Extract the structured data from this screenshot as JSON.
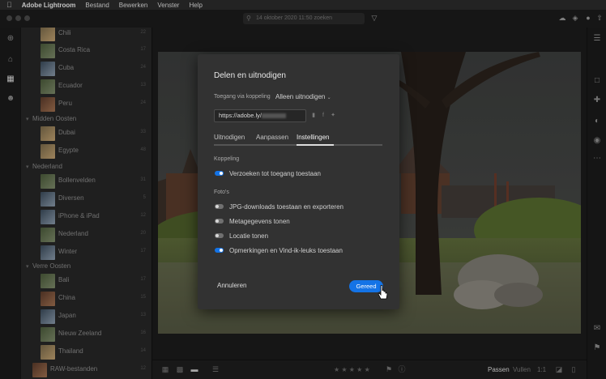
{
  "menubar": {
    "app_name": "Adobe Lightroom",
    "items": [
      "Bestand",
      "Bewerken",
      "Venster",
      "Help"
    ]
  },
  "toolbar": {
    "search_placeholder": "14 oktober 2020 11:50 zoeken"
  },
  "sidebar": {
    "rows": [
      {
        "label": "Chili",
        "count": "22",
        "kind": "album"
      },
      {
        "label": "Costa Rica",
        "count": "17",
        "kind": "album"
      },
      {
        "label": "Cuba",
        "count": "24",
        "kind": "album"
      },
      {
        "label": "Ecuador",
        "count": "13",
        "kind": "album"
      },
      {
        "label": "Peru",
        "count": "24",
        "kind": "album"
      },
      {
        "label": "Midden Oosten",
        "count": "",
        "kind": "group"
      },
      {
        "label": "Dubai",
        "count": "33",
        "kind": "album"
      },
      {
        "label": "Egypte",
        "count": "48",
        "kind": "album"
      },
      {
        "label": "Nederland",
        "count": "",
        "kind": "group"
      },
      {
        "label": "Bollenvelden",
        "count": "31",
        "kind": "album"
      },
      {
        "label": "Diversen",
        "count": "5",
        "kind": "album"
      },
      {
        "label": "iPhone & iPad",
        "count": "12",
        "kind": "album"
      },
      {
        "label": "Nederland",
        "count": "20",
        "kind": "album"
      },
      {
        "label": "Winter",
        "count": "17",
        "kind": "album"
      },
      {
        "label": "Verre Oosten",
        "count": "",
        "kind": "group"
      },
      {
        "label": "Bali",
        "count": "17",
        "kind": "album"
      },
      {
        "label": "China",
        "count": "15",
        "kind": "album"
      },
      {
        "label": "Japan",
        "count": "13",
        "kind": "album"
      },
      {
        "label": "Nieuw Zeeland",
        "count": "16",
        "kind": "album"
      },
      {
        "label": "Thailand",
        "count": "14",
        "kind": "album"
      },
      {
        "label": "RAW-bestanden",
        "count": "12",
        "kind": "album"
      }
    ]
  },
  "bottombar": {
    "fit_label": "Passen",
    "fill_label": "Vullen",
    "ratio_label": "1:1",
    "stars": "★ ★ ★ ★ ★"
  },
  "dialog": {
    "title": "Delen en uitnodigen",
    "access_label": "Toegang via koppeling",
    "access_value": "Alleen uitnodigen",
    "link_value": "https://adobe.ly/",
    "tabs": [
      "Uitnodigen",
      "Aanpassen",
      "Instellingen"
    ],
    "section_link": "Koppeling",
    "opt_request_access": "Verzoeken tot toegang toestaan",
    "section_photos": "Foto's",
    "opt_jpg": "JPG-downloads toestaan  en exporteren",
    "opt_metadata": "Metagegevens tonen",
    "opt_location": "Locatie tonen",
    "opt_comments": "Opmerkingen en Vind-ik-leuks toestaan",
    "cancel_label": "Annuleren",
    "done_label": "Gereed"
  },
  "toggles": {
    "request_access": true,
    "jpg": false,
    "metadata": false,
    "location": false,
    "comments": true
  },
  "colors": {
    "accent": "#1473e6",
    "dialog_bg": "#323232",
    "sidebar_bg": "#262626"
  }
}
